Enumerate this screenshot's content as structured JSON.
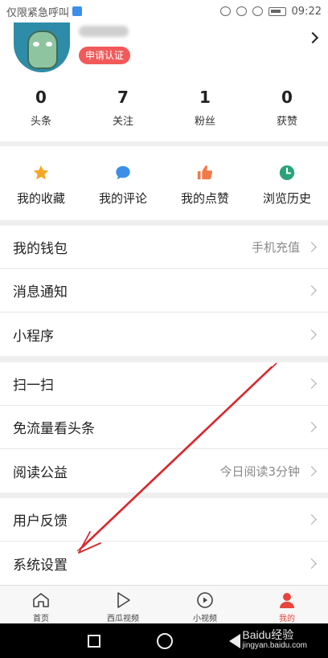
{
  "status_bar": {
    "carrier_text": "仅限紧急呼叫",
    "time": "09:22"
  },
  "profile": {
    "cert_label": "申请认证"
  },
  "stats": [
    {
      "value": "0",
      "label": "头条"
    },
    {
      "value": "7",
      "label": "关注"
    },
    {
      "value": "1",
      "label": "粉丝"
    },
    {
      "value": "0",
      "label": "获赞"
    }
  ],
  "quick_actions": [
    {
      "label": "我的收藏",
      "icon": "star-icon",
      "color": "#f5a623"
    },
    {
      "label": "我的评论",
      "icon": "comment-icon",
      "color": "#3d8ee8"
    },
    {
      "label": "我的点赞",
      "icon": "like-icon",
      "color": "#f07a4a"
    },
    {
      "label": "浏览历史",
      "icon": "history-icon",
      "color": "#2aa37a"
    }
  ],
  "menu_group_1": [
    {
      "label": "我的钱包",
      "hint": "手机充值"
    },
    {
      "label": "消息通知",
      "hint": ""
    },
    {
      "label": "小程序",
      "hint": ""
    }
  ],
  "menu_group_2": [
    {
      "label": "扫一扫",
      "hint": ""
    },
    {
      "label": "免流量看头条",
      "hint": ""
    },
    {
      "label": "阅读公益",
      "hint": "今日阅读3分钟"
    }
  ],
  "menu_group_3": [
    {
      "label": "用户反馈",
      "hint": ""
    },
    {
      "label": "系统设置",
      "hint": ""
    }
  ],
  "tabs": [
    {
      "label": "首页",
      "icon": "home-icon"
    },
    {
      "label": "西瓜视频",
      "icon": "play-icon"
    },
    {
      "label": "小视频",
      "icon": "small-video-icon"
    },
    {
      "label": "我的",
      "icon": "person-icon",
      "active": true
    }
  ],
  "watermark": {
    "brand": "Baidu经验",
    "url": "jingyan.baidu.com"
  },
  "colors": {
    "accent": "#e8453c",
    "badge": "#f25a5a",
    "annotation": "#d9252a"
  }
}
